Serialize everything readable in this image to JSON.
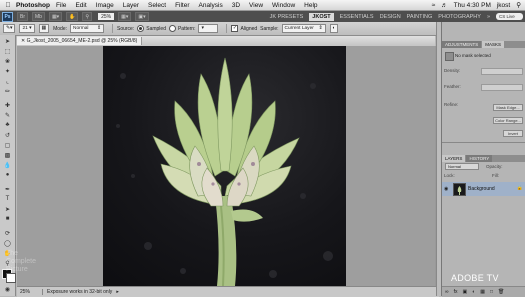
{
  "menubar": {
    "app_name": "Photoshop",
    "items": [
      "File",
      "Edit",
      "Image",
      "Layer",
      "Select",
      "Filter",
      "Analysis",
      "3D",
      "View",
      "Window",
      "Help"
    ],
    "clock": "Thu 4:30 PM",
    "user": "jkost"
  },
  "appbar": {
    "ps_label": "Ps",
    "zoom": "25%",
    "workspaces": [
      "JK PRESETS",
      "JKOST",
      "ESSENTIALS",
      "DESIGN",
      "PAINTING",
      "PHOTOGRAPHY"
    ],
    "active_workspace": "JKOST",
    "overflow": "»",
    "live_label": "CS Live"
  },
  "options": {
    "brush_size": "21",
    "mode_label": "Mode:",
    "mode_value": "Normal",
    "source_label": "Source:",
    "sampled_label": "Sampled",
    "pattern_label": "Pattern:",
    "aligned_label": "Aligned",
    "sample_label": "Sample:",
    "sample_value": "Current Layer"
  },
  "document": {
    "tab_title": "G_Jkost_2005_06654_ME-2.psd @ 25% (RGB/8)",
    "status_zoom": "25%",
    "status_message": "Exposure works in 32-bit only"
  },
  "adjustments": {
    "tabs": [
      "ADJUSTMENTS",
      "MASKS"
    ],
    "active_tab": "MASKS",
    "no_mask": "No mask selected",
    "density_label": "Density:",
    "feather_label": "Feather:",
    "refine_label": "Refine:",
    "mask_edge": "Mask Edge...",
    "color_range": "Color Range...",
    "invert": "Invert"
  },
  "layers": {
    "tabs": [
      "LAYERS",
      "HISTORY"
    ],
    "active_tab": "LAYERS",
    "blend_mode": "Normal",
    "opacity_label": "Opacity:",
    "lock_label": "Lock:",
    "fill_label": "Fill:",
    "layer_name": "Background"
  },
  "watermark": {
    "lines": [
      "The",
      "Complete",
      "Picture"
    ]
  },
  "brand": "ADOBE TV",
  "colors": {
    "workspace_active_bg": "#d9d9d9",
    "artwork_bg": "#16161a",
    "artichoke_green": "#b9cf8f"
  }
}
